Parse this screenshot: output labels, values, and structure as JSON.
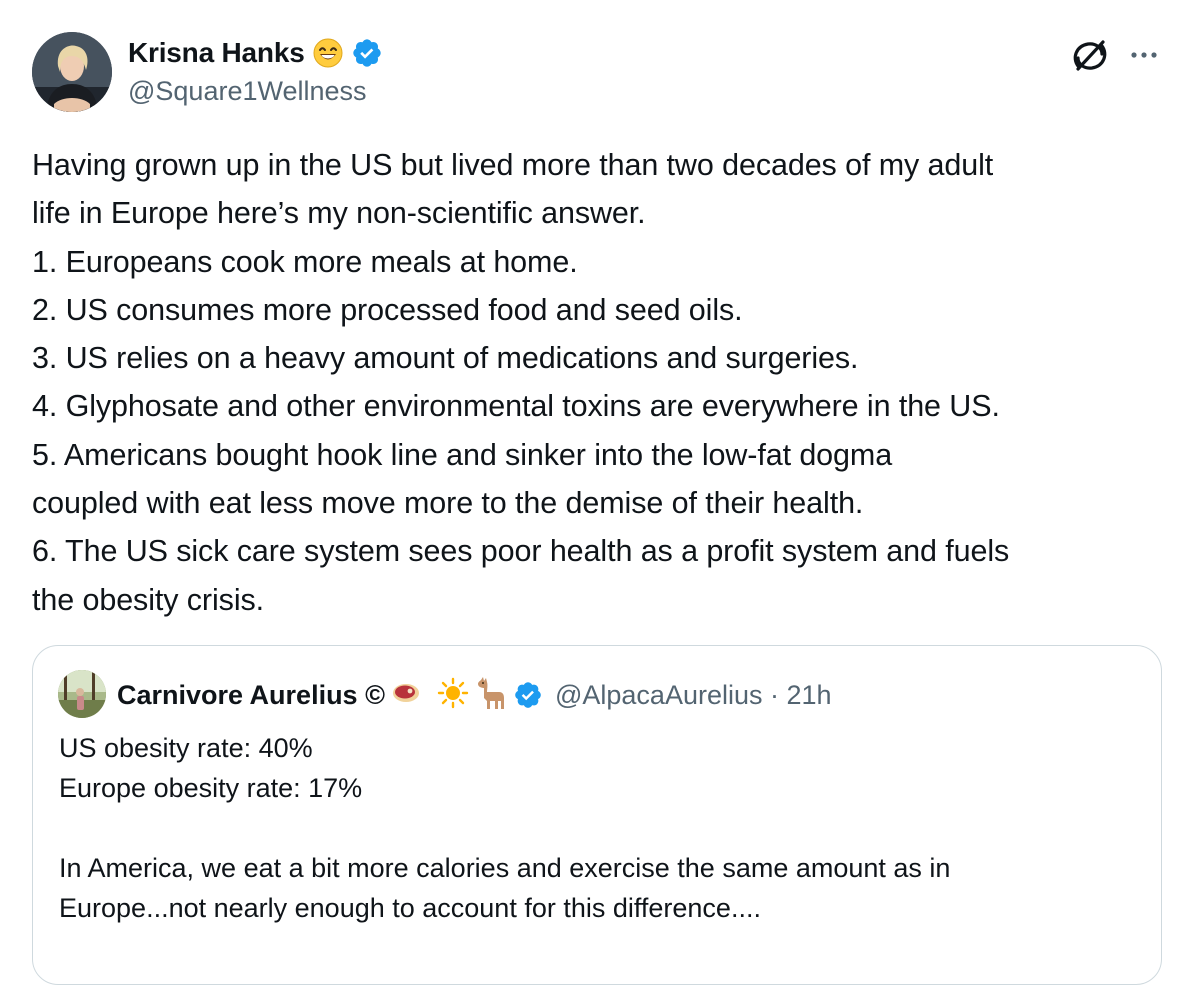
{
  "author": {
    "display_name": "Krisna Hanks",
    "name_emoji": "grinning-face-with-smiling-eyes",
    "verified": true,
    "handle": "@Square1Wellness"
  },
  "actions": {
    "grok_icon": "grok-icon",
    "more_icon": "more-horizontal-icon"
  },
  "post": {
    "lines": [
      "Having grown up in the US but lived more than two decades of my adult",
      "life in Europe here’s my non-scientific answer.",
      "1. Europeans cook more meals at home.",
      "2. US consumes more processed food and seed oils.",
      "3. US relies  on a heavy amount of medications and surgeries.",
      "4. Glyphosate and other environmental toxins are everywhere in the US.",
      "5. Americans bought hook line and sinker into the low-fat dogma",
      "coupled with eat less move more to the demise of their health.",
      "6. The US sick care system sees poor health as a profit system and fuels",
      "the obesity crisis."
    ]
  },
  "quoted": {
    "display_name": "Carnivore Aurelius ©",
    "name_emojis": [
      "steak",
      "sun",
      "llama"
    ],
    "verified": true,
    "handle_time": "@AlpacaAurelius · 21h",
    "lines": [
      "US obesity rate: 40%",
      "Europe obesity rate: 17%",
      "",
      "In America, we eat a bit more calories and exercise the same amount as in",
      "Europe...not nearly enough to account for this difference...."
    ]
  },
  "colors": {
    "text": "#0f1419",
    "secondary": "#536471",
    "verified_blue": "#1d9bf0",
    "border": "#cfd9de"
  }
}
